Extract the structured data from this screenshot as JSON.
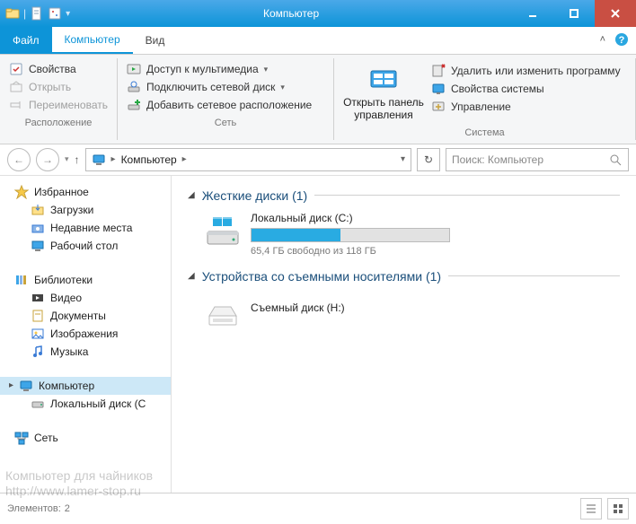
{
  "window": {
    "title": "Компьютер"
  },
  "ribbon_tabs": {
    "file": "Файл",
    "computer": "Компьютер",
    "view": "Вид"
  },
  "ribbon": {
    "location": {
      "properties": "Свойства",
      "open": "Открыть",
      "rename": "Переименовать",
      "group": "Расположение"
    },
    "network": {
      "media": "Доступ к мультимедиа",
      "map": "Подключить сетевой диск",
      "addloc": "Добавить сетевое расположение",
      "group": "Сеть"
    },
    "control": {
      "open_cp": "Открыть панель управления",
      "uninstall": "Удалить или изменить программу",
      "sysprops": "Свойства системы",
      "manage": "Управление",
      "group": "Система"
    }
  },
  "nav": {
    "breadcrumb": "Компьютер",
    "search_placeholder": "Поиск: Компьютер"
  },
  "tree": {
    "favorites": "Избранное",
    "downloads": "Загрузки",
    "recent": "Недавние места",
    "desktop": "Рабочий стол",
    "libraries": "Библиотеки",
    "video": "Видео",
    "documents": "Документы",
    "pictures": "Изображения",
    "music": "Музыка",
    "computer": "Компьютер",
    "localc": "Локальный диск (C",
    "network": "Сеть"
  },
  "content": {
    "hdd_header": "Жесткие диски (1)",
    "drive_c": {
      "name": "Локальный диск (C:)",
      "free_text": "65,4 ГБ свободно из 118 ГБ",
      "fill_percent": 45
    },
    "removable_header": "Устройства со съемными носителями (1)",
    "removable": {
      "name": "Съемный диск (H:)"
    }
  },
  "status": {
    "items_label": "Элементов:",
    "items_count": "2"
  },
  "watermark": {
    "line1": "Компьютер для чайников",
    "line2": "http://www.lamer-stop.ru"
  }
}
